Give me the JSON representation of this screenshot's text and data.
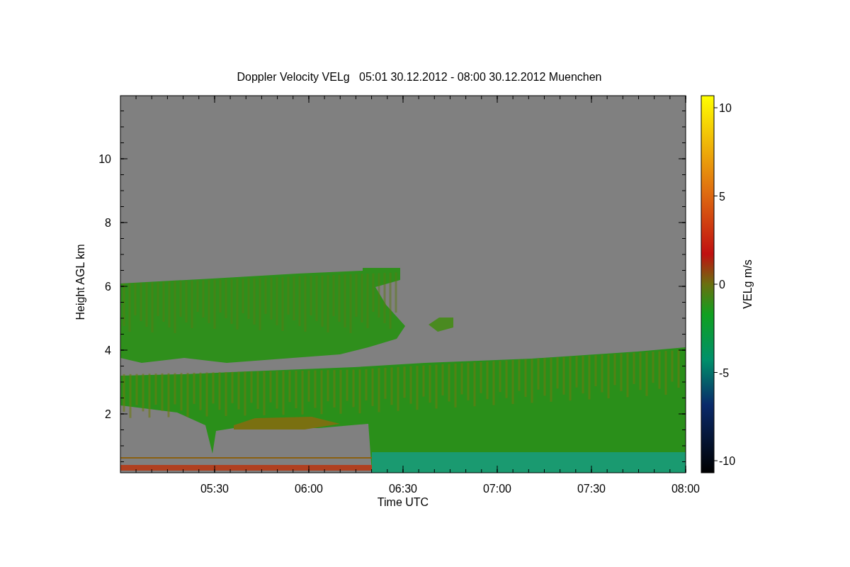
{
  "plot": {
    "title": "Doppler Velocity VELg   05:01 30.12.2012 - 08:00 30.12.2012 Muenchen",
    "xlabel": "Time UTC",
    "ylabel": "Height AGL km",
    "xticks": [
      "05:30",
      "06:00",
      "06:30",
      "07:00",
      "07:30",
      "08:00"
    ],
    "yticks": [
      "10",
      "8",
      "6",
      "4",
      "2"
    ],
    "colorbar": {
      "label": "VELg m/s",
      "ticks": [
        "10",
        "5",
        "0",
        "-5",
        "-10"
      ]
    }
  }
}
